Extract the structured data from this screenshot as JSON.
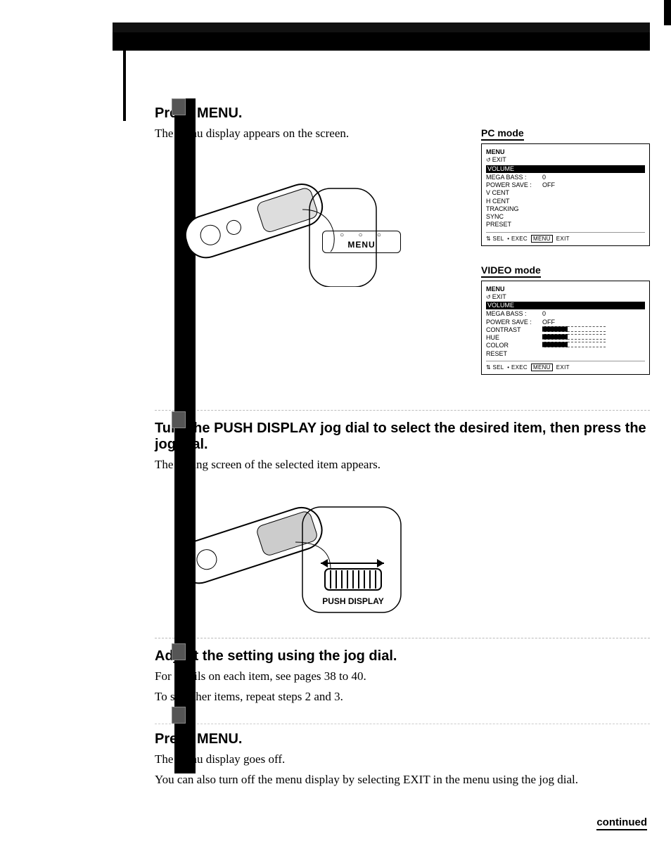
{
  "steps": {
    "s1": {
      "title": "Press MENU.",
      "body": "The menu display appears on the screen.",
      "menu_label": "MENU"
    },
    "s2": {
      "title": "Turn the PUSH DISPLAY jog dial to select the desired item, then press the jog dial.",
      "body": "The setting screen of the selected item appears.",
      "dial_label": "PUSH DISPLAY"
    },
    "s3": {
      "title": "Adjust the setting using the jog dial.",
      "body1": "For details on each item, see pages 38 to 40.",
      "body2": "To set other items, repeat steps 2 and 3."
    },
    "s4": {
      "title": "Press MENU.",
      "body1": "The menu display goes off.",
      "body2": "You can also turn off the menu display by selecting EXIT in the menu using the jog dial."
    }
  },
  "pc": {
    "mode_title": "PC mode",
    "menu": "MENU",
    "exit": "EXIT",
    "selected": {
      "k": "VOLUME",
      "v": ""
    },
    "rows": [
      {
        "k": "MEGA BASS :",
        "v": "0"
      },
      {
        "k": "POWER SAVE :",
        "v": "OFF"
      },
      {
        "k": "V CENT",
        "v": ""
      },
      {
        "k": "H CENT",
        "v": ""
      },
      {
        "k": "TRACKING",
        "v": ""
      },
      {
        "k": "SYNC",
        "v": ""
      },
      {
        "k": "PRESET",
        "v": ""
      }
    ],
    "hint_sel": "SEL",
    "hint_exec": "EXEC",
    "hint_menu": "MENU",
    "hint_exit": "EXIT"
  },
  "video": {
    "mode_title": "VIDEO mode",
    "menu": "MENU",
    "exit": "EXIT",
    "selected": {
      "k": "VOLUME",
      "v": ""
    },
    "rows": [
      {
        "k": "MEGA BASS :",
        "v": "0",
        "bar": false
      },
      {
        "k": "POWER SAVE :",
        "v": "OFF",
        "bar": false
      },
      {
        "k": "CONTRAST",
        "v": "",
        "bar": true
      },
      {
        "k": "HUE",
        "v": "",
        "bar": true
      },
      {
        "k": "COLOR",
        "v": "",
        "bar": true
      },
      {
        "k": "RESET",
        "v": "",
        "bar": false
      }
    ],
    "hint_sel": "SEL",
    "hint_exec": "EXEC",
    "hint_menu": "MENU",
    "hint_exit": "EXIT"
  },
  "continued": "continued"
}
